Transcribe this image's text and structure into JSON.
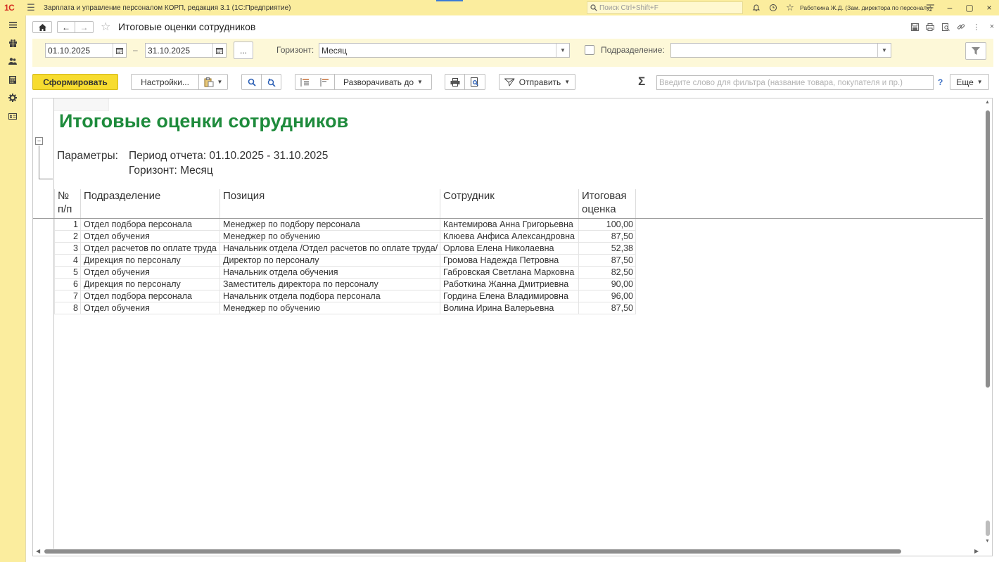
{
  "app": {
    "logo": "1С",
    "title": "Зарплата и управление персоналом КОРП, редакция 3.1  (1С:Предприятие)",
    "search_placeholder": "Поиск Ctrl+Shift+F",
    "user": "Работкина Ж.Д. (Зам. директора по персоналу)"
  },
  "form": {
    "title": "Итоговые оценки сотрудников"
  },
  "filters": {
    "date_from": "01.10.2025",
    "date_sep": "–",
    "date_to": "31.10.2025",
    "period_button": "...",
    "horizon_label": "Горизонт:",
    "horizon_value": "Месяц",
    "division_label": "Подразделение:",
    "division_value": ""
  },
  "toolbar": {
    "generate": "Сформировать",
    "settings": "Настройки...",
    "expand_to": "Разворачивать до",
    "send": "Отправить",
    "filter_placeholder": "Введите слово для фильтра (название товара, покупателя и пр.)",
    "help": "?",
    "more": "Еще"
  },
  "report": {
    "title": "Итоговые оценки сотрудников",
    "params_label": "Параметры:",
    "period": "Период отчета: 01.10.2025 - 31.10.2025",
    "horizon": "Горизонт: Месяц",
    "columns": {
      "num_l1": "№",
      "num_l2": "п/п",
      "division": "Подразделение",
      "position": "Позиция",
      "employee": "Сотрудник",
      "score_l1": "Итоговая",
      "score_l2": "оценка"
    },
    "rows": [
      {
        "n": "1",
        "division": "Отдел подбора персонала",
        "position": "Менеджер по подбору персонала",
        "employee": "Кантемирова Анна Григорьевна",
        "score": "100,00"
      },
      {
        "n": "2",
        "division": "Отдел обучения",
        "position": "Менеджер по обучению",
        "employee": "Клюева Анфиса Александровна",
        "score": "87,50"
      },
      {
        "n": "3",
        "division": "Отдел расчетов по оплате труда",
        "position": "Начальник отдела /Отдел расчетов по оплате труда/",
        "employee": "Орлова Елена Николаевна",
        "score": "52,38"
      },
      {
        "n": "4",
        "division": "Дирекция по персоналу",
        "position": "Директор по персоналу",
        "employee": "Громова Надежда Петровна",
        "score": "87,50"
      },
      {
        "n": "5",
        "division": "Отдел обучения",
        "position": "Начальник отдела обучения",
        "employee": "Габровская Светлана Марковна",
        "score": "82,50"
      },
      {
        "n": "6",
        "division": "Дирекция по персоналу",
        "position": "Заместитель директора по персоналу",
        "employee": "Работкина Жанна Дмитриевна",
        "score": "90,00"
      },
      {
        "n": "7",
        "division": "Отдел подбора персонала",
        "position": "Начальник отдела подбора персонала",
        "employee": "Гордина Елена Владимировна",
        "score": "96,00"
      },
      {
        "n": "8",
        "division": "Отдел обучения",
        "position": "Менеджер по обучению",
        "employee": "Волина Ирина Валерьевна",
        "score": "87,50"
      }
    ]
  },
  "colors": {
    "accent_yellow": "#f7dc2f",
    "frame_yellow": "#fbed9e",
    "title_green": "#1e8b3c"
  }
}
